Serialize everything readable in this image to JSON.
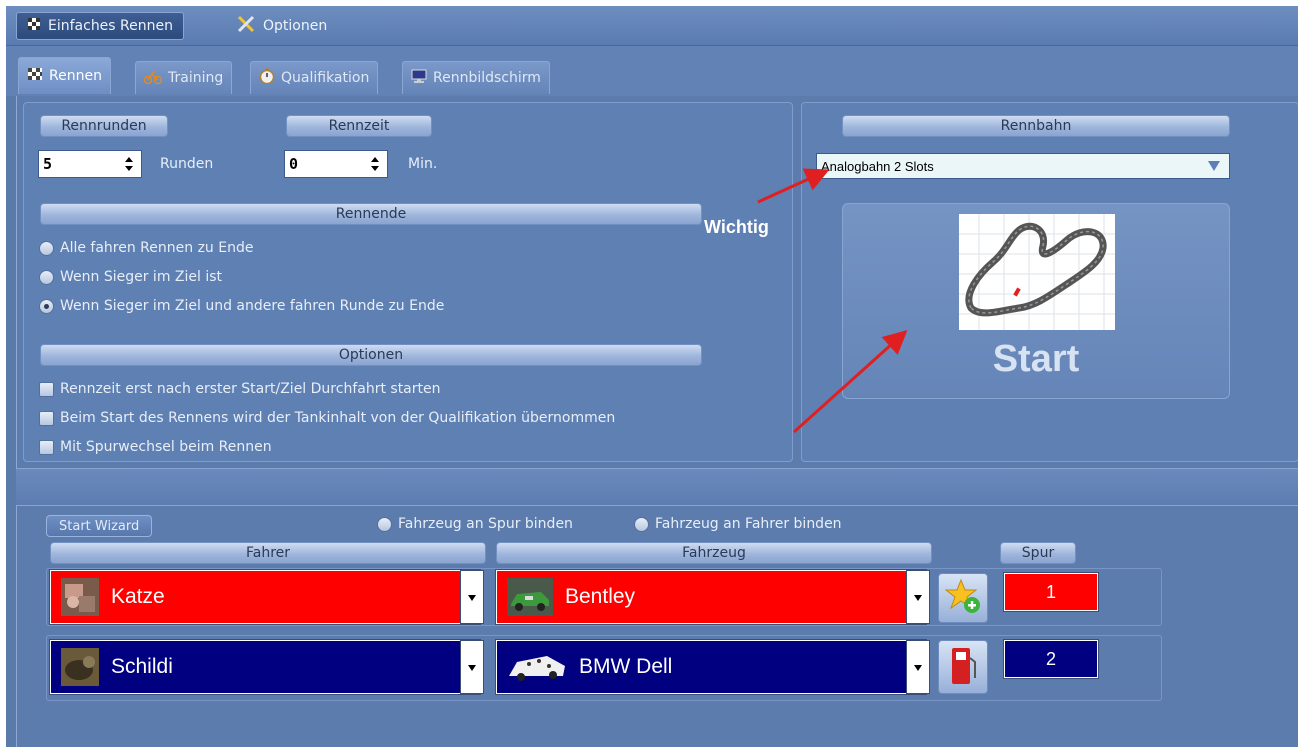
{
  "menubar": {
    "items": [
      {
        "label": "Einfaches Rennen",
        "icon": "checkered-flag-icon"
      },
      {
        "label": "Optionen",
        "icon": "tools-icon"
      }
    ]
  },
  "tabs": [
    {
      "label": "Rennen",
      "icon": "checkered-flag-icon",
      "active": true
    },
    {
      "label": "Training",
      "icon": "cyclist-icon"
    },
    {
      "label": "Qualifikation",
      "icon": "stopwatch-icon"
    },
    {
      "label": "Rennbildschirm",
      "icon": "monitor-icon"
    }
  ],
  "race": {
    "rounds_header": "Rennrunden",
    "rounds_value": "5",
    "rounds_unit": "Runden",
    "time_header": "Rennzeit",
    "time_value": "0",
    "time_unit": "Min.",
    "end_header": "Rennende",
    "end_options": [
      "Alle fahren Rennen zu Ende",
      "Wenn Sieger im Ziel ist",
      "Wenn Sieger im Ziel und andere fahren Runde zu Ende"
    ],
    "end_selected_index": 2,
    "options_header": "Optionen",
    "options": [
      "Rennzeit erst nach erster Start/Ziel Durchfahrt starten",
      "Beim Start des Rennens wird der Tankinhalt von der Qualifikation übernommen",
      "Mit Spurwechsel beim Rennen"
    ]
  },
  "track": {
    "header": "Rennbahn",
    "selected": "Analogbahn 2 Slots",
    "start_label": "Start",
    "annotation": "Wichtig"
  },
  "drivers": {
    "wizard_label": "Start Wizard",
    "bind_options": [
      "Fahrzeug an Spur binden",
      "Fahrzeug an Fahrer binden"
    ],
    "col_driver": "Fahrer",
    "col_car": "Fahrzeug",
    "col_lane": "Spur",
    "rows": [
      {
        "driver": "Katze",
        "car": "Bentley",
        "lane": "1",
        "color": "#ff0000",
        "action_icon": "star-add-icon"
      },
      {
        "driver": "Schildi",
        "car": "BMW Dell",
        "lane": "2",
        "color": "#000080",
        "action_icon": "fuel-pump-icon"
      }
    ]
  }
}
